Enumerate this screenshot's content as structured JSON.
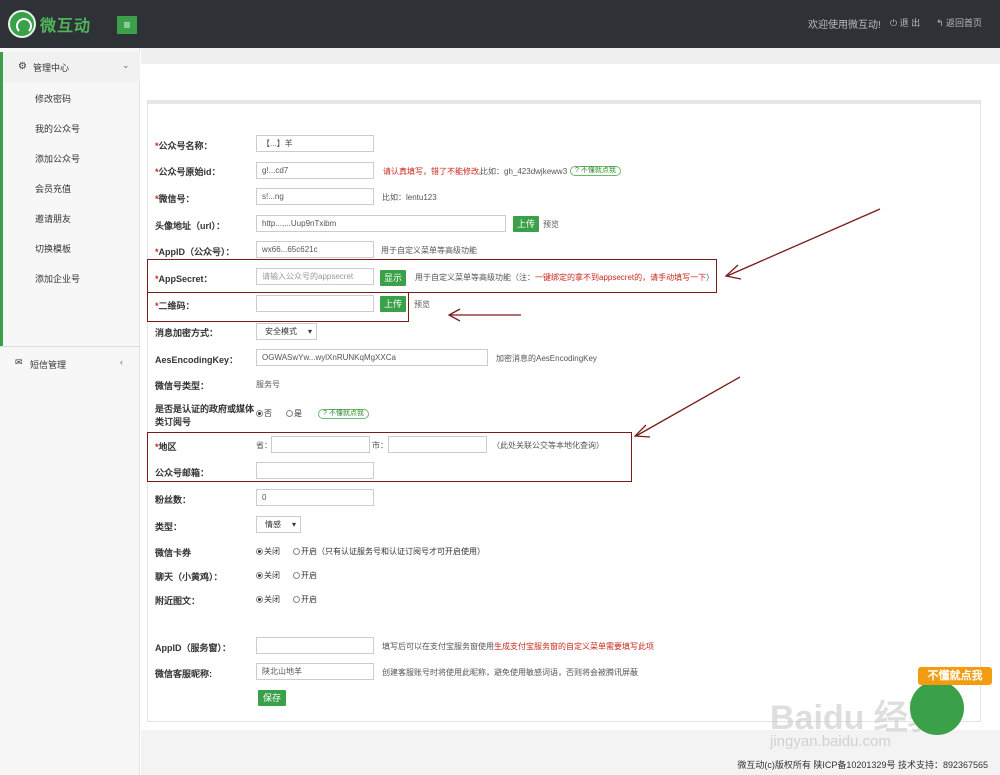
{
  "topbar": {
    "brand": "微互动",
    "welcome": "欢迎使用微互动!",
    "logout": "退 出",
    "home": "返回首页"
  },
  "sidebar": {
    "header": "管理中心",
    "items": [
      "修改密码",
      "我的公众号",
      "添加公众号",
      "会员充值",
      "邀请朋友",
      "切换模板",
      "添加企业号"
    ],
    "sms": "短信管理"
  },
  "form": {
    "name": {
      "label": "公众号名称：",
      "value": "【...】羊"
    },
    "origid": {
      "label": "公众号原始id：",
      "value": "g!...cd7",
      "warn": "请认真填写，错了不能修改。",
      "example": "比如：gh_423dwjkeww3",
      "help": "? 不懂就点我"
    },
    "wechat": {
      "label": "微信号：",
      "value": "s!...ng",
      "example": "比如：lentu123"
    },
    "avatar": {
      "label": "头像地址（url）：",
      "value": "http...,...Uup9nTxibm",
      "upload": "上传",
      "preview": "预览"
    },
    "appid": {
      "label": "AppID（公众号）：",
      "value": "wx66...65c621c",
      "note": "用于自定义菜单等高级功能"
    },
    "secret": {
      "label": "AppSecret：",
      "placeholder": "请输入公众号的appsecret",
      "show": "显示",
      "note": "用于自定义菜单等高级功能（注：",
      "note_red": "一键绑定的拿不到appsecret的，请手动填写一下",
      "note_end": "）"
    },
    "qrcode": {
      "label": "二维码：",
      "upload": "上传",
      "preview": "预览"
    },
    "encrypt": {
      "label": "消息加密方式：",
      "value": "安全模式"
    },
    "aeskey": {
      "label": "AesEncodingKey：",
      "value": "OGWASwYw...wylXnRUNKqMgXXCa",
      "note": "加密消息的AesEncodingKey"
    },
    "type": {
      "label": "微信号类型：",
      "value": "服务号"
    },
    "certified": {
      "label_1": "是否是认证的政府或媒体",
      "label_2": "类订阅号",
      "no": "否",
      "yes": "是",
      "help": "? 不懂就点我"
    },
    "region": {
      "label": "地区",
      "province": "省：",
      "city": "市：",
      "note": "（此处关联公交等本地化查询）"
    },
    "email": {
      "label": "公众号邮箱："
    },
    "fans": {
      "label": "粉丝数：",
      "value": "0"
    },
    "category": {
      "label": "类型：",
      "value": "情感"
    },
    "card": {
      "label": "微信卡券",
      "off": "关闭",
      "on": "开启（只有认证服务号和认证订阅号才可开启使用）"
    },
    "chat": {
      "label": "聊天（小黄鸡）：",
      "off": "关闭",
      "on": "开启"
    },
    "nearby": {
      "label": "附近图文：",
      "off": "关闭",
      "on": "开启"
    },
    "appid_service": {
      "label": "AppID（服务窗）：",
      "note": "填写后可以在支付宝服务窗使用",
      "note_red": "生成支付宝服务窗的自定义菜单需要填写此项"
    },
    "nickname": {
      "label": "微信客服昵称:",
      "value": "陕北山地羊",
      "note": "创建客服账号时将使用此昵称，避免使用敏感词语，否则将会被腾讯屏蔽"
    },
    "save": "保存"
  },
  "footer": {
    "text": "微互动(c)版权所有 陕ICP备10201329号 技术支持：892367565"
  },
  "badge": {
    "text": "不懂就点我"
  },
  "watermark": {
    "main": "Baidu 经验",
    "sub": "jingyan.baidu.com"
  },
  "colors": {
    "accent": "#3aa04a",
    "topbar": "#2e3135",
    "required": "#c7291c",
    "annotation": "#7a1b1b"
  }
}
